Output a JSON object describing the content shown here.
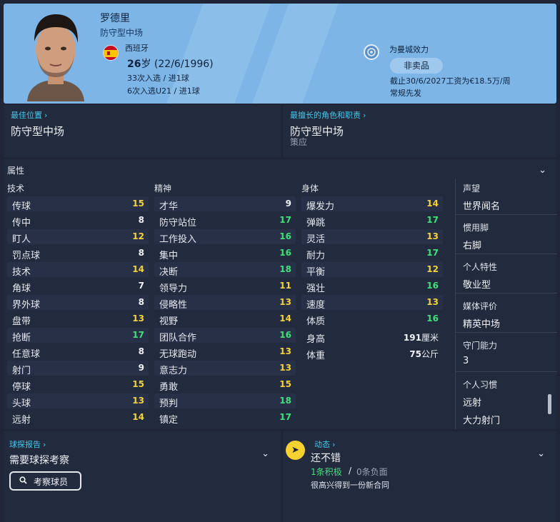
{
  "header": {
    "name": "罗德里",
    "position": "防守型中场",
    "nation": "西班牙",
    "age_prefix": "26",
    "age_suffix": "岁 (22/6/1996)",
    "caps": "33次入选 / 进1球",
    "u21_caps": "6次入选U21 / 进1球",
    "club": "为曼城效力",
    "transfer_status": "非卖品",
    "contract": "截止30/6/2027工资为€18.5万/周",
    "squad_role": "常规先发"
  },
  "best_position": {
    "link": "最佳位置",
    "value": "防守型中场"
  },
  "best_role": {
    "link": "最擅长的角色和职责",
    "value": "防守型中场",
    "duty": "策应"
  },
  "attributes": {
    "title": "属性",
    "technical": {
      "header": "技术",
      "items": [
        {
          "label": "传球",
          "value": "15"
        },
        {
          "label": "传中",
          "value": "8"
        },
        {
          "label": "盯人",
          "value": "12"
        },
        {
          "label": "罚点球",
          "value": "8"
        },
        {
          "label": "技术",
          "value": "14"
        },
        {
          "label": "角球",
          "value": "7"
        },
        {
          "label": "界外球",
          "value": "8"
        },
        {
          "label": "盘带",
          "value": "13"
        },
        {
          "label": "抢断",
          "value": "17"
        },
        {
          "label": "任意球",
          "value": "8"
        },
        {
          "label": "射门",
          "value": "9"
        },
        {
          "label": "停球",
          "value": "15"
        },
        {
          "label": "头球",
          "value": "13"
        },
        {
          "label": "远射",
          "value": "14"
        }
      ]
    },
    "mental": {
      "header": "精神",
      "items": [
        {
          "label": "才华",
          "value": "9"
        },
        {
          "label": "防守站位",
          "value": "17"
        },
        {
          "label": "工作投入",
          "value": "16"
        },
        {
          "label": "集中",
          "value": "16"
        },
        {
          "label": "决断",
          "value": "18"
        },
        {
          "label": "领导力",
          "value": "11"
        },
        {
          "label": "侵略性",
          "value": "13"
        },
        {
          "label": "视野",
          "value": "14"
        },
        {
          "label": "团队合作",
          "value": "16"
        },
        {
          "label": "无球跑动",
          "value": "13"
        },
        {
          "label": "意志力",
          "value": "13"
        },
        {
          "label": "勇敢",
          "value": "15"
        },
        {
          "label": "预判",
          "value": "18"
        },
        {
          "label": "镇定",
          "value": "17"
        }
      ]
    },
    "physical": {
      "header": "身体",
      "items": [
        {
          "label": "爆发力",
          "value": "14"
        },
        {
          "label": "弹跳",
          "value": "17"
        },
        {
          "label": "灵活",
          "value": "13"
        },
        {
          "label": "耐力",
          "value": "17"
        },
        {
          "label": "平衡",
          "value": "12"
        },
        {
          "label": "强壮",
          "value": "16"
        },
        {
          "label": "速度",
          "value": "13"
        },
        {
          "label": "体质",
          "value": "16"
        }
      ],
      "height_label": "身高",
      "height_value": "191",
      "height_unit": "厘米",
      "weight_label": "体重",
      "weight_value": "75",
      "weight_unit": "公斤"
    }
  },
  "info": [
    {
      "label": "声望",
      "value": "世界闻名"
    },
    {
      "label": "惯用脚",
      "value": "右脚"
    },
    {
      "label": "个人特性",
      "value": "敬业型"
    },
    {
      "label": "媒体评价",
      "value": "精英中场"
    },
    {
      "label": "守门能力",
      "value": "3"
    },
    {
      "label": "个人习惯",
      "value": "远射",
      "value2": "大力射门"
    }
  ],
  "scout": {
    "link": "球探报告",
    "status": "需要球探考察",
    "button": "考察球员"
  },
  "dynamics": {
    "link": "动态",
    "status": "还不错",
    "positive": "1条积极",
    "separator": "/",
    "negative": "0条负面",
    "note": "很高兴得到一份新合同"
  },
  "colors": {
    "green": "#3fe07a",
    "yellow": "#f3d23a",
    "white": "#f0f2f6",
    "header": "#7cb5e6",
    "link": "#46c8ec"
  }
}
